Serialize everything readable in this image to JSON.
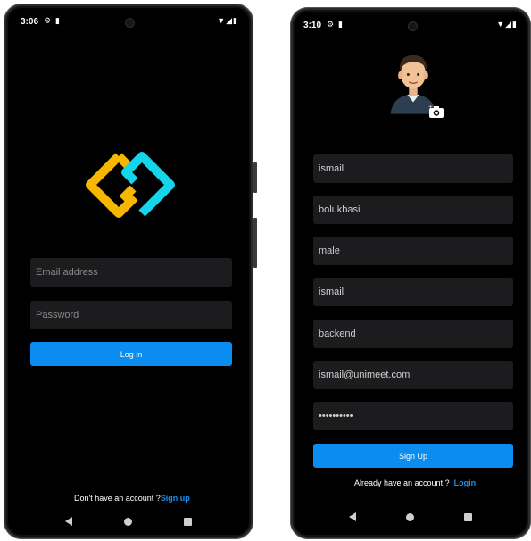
{
  "login_screen": {
    "status": {
      "time": "3:06"
    },
    "email_placeholder": "Email address",
    "password_placeholder": "Password",
    "login_button": "Log in",
    "footer_prompt": "Don't have an account ?",
    "footer_link": "Sign up",
    "logo_colors": {
      "primary": "#f5b700",
      "secondary": "#13d6ec"
    }
  },
  "signup_screen": {
    "status": {
      "time": "3:10"
    },
    "fields": [
      {
        "name": "first-name",
        "value": "ismail"
      },
      {
        "name": "last-name",
        "value": "bolukbasi"
      },
      {
        "name": "gender",
        "value": "male"
      },
      {
        "name": "username",
        "value": "ismail"
      },
      {
        "name": "department",
        "value": "backend"
      },
      {
        "name": "email",
        "value": "ismail@unimeet.com"
      },
      {
        "name": "password",
        "value": "••••••••••"
      }
    ],
    "signup_button": "Sign Up",
    "footer_prompt": "Already have an account ?",
    "footer_link": "Login"
  },
  "icons": [
    "settings-icon",
    "sd-card-icon",
    "wifi-icon",
    "signal-icon",
    "battery-icon",
    "camera-add-icon",
    "back-icon",
    "home-icon",
    "recents-icon"
  ],
  "colors": {
    "background": "#000000",
    "field": "#1c1c1e",
    "accent": "#0a8cf0",
    "link": "#1a8ff0"
  }
}
